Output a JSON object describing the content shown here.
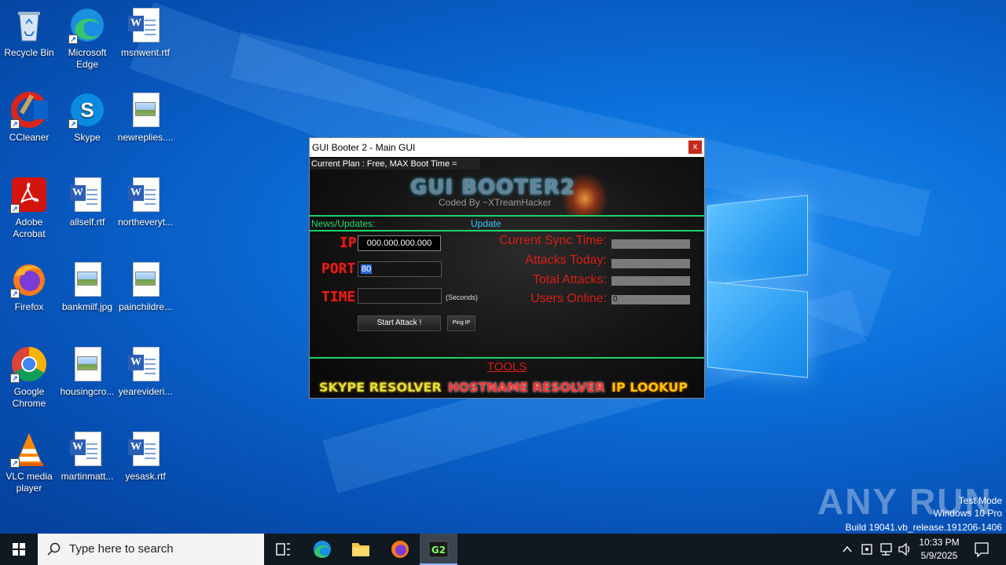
{
  "desktop": {
    "icons": [
      {
        "label": "Recycle Bin"
      },
      {
        "label": "Microsoft Edge"
      },
      {
        "label": "msnwent.rtf"
      },
      {
        "label": "CCleaner"
      },
      {
        "label": "Skype"
      },
      {
        "label": "newreplies...."
      },
      {
        "label": "Adobe Acrobat"
      },
      {
        "label": "allself.rtf"
      },
      {
        "label": "northeveryt..."
      },
      {
        "label": "Firefox"
      },
      {
        "label": "bankmilf.jpg"
      },
      {
        "label": "painchildre..."
      },
      {
        "label": "Google Chrome"
      },
      {
        "label": "housingcro..."
      },
      {
        "label": "yearevideri..."
      },
      {
        "label": "VLC media player"
      },
      {
        "label": "martinmatt..."
      },
      {
        "label": "yesask.rtf"
      }
    ]
  },
  "window": {
    "title": "GUI Booter 2 - Main GUI",
    "close_label": "x",
    "plan_text": "Current Plan : Free,  MAX Boot Time =",
    "logo_text": "GUI BOOTER2",
    "logo_sub": "Coded By ~XTreamHacker",
    "news_label": "News/Updates:",
    "update_label": "Update",
    "ip_label": "IP:",
    "ip_value": "000.000.000.000",
    "port_label": "PORT:",
    "port_value": "80",
    "time_label": "TIME:",
    "time_value": "",
    "seconds_label": "(Seconds)",
    "start_button": "Start Attack !",
    "ping_button": "Ping IP",
    "stats": {
      "sync_label": "Current Sync Time:",
      "attacks_today_label": "Attacks Today:",
      "total_attacks_label": "Total Attacks:",
      "users_online_label": "Users Online:",
      "users_online_value": "0"
    },
    "tools_title": "TOOLS",
    "tools": {
      "skype": "SKYPE RESOLVER",
      "hostname": "HOSTNAME RESOLVER",
      "ip_lookup": "IP LOOKUP"
    }
  },
  "watermark": {
    "brand": "ANY RUN",
    "test_mode": "Test Mode",
    "edition": "Windows 10 Pro",
    "build": "Build 19041.vb_release.191206-1406"
  },
  "taskbar": {
    "search_placeholder": "Type here to search",
    "time": "10:33 PM",
    "date": "5/9/2025"
  },
  "colors": {
    "accent_green": "#19d36a",
    "label_red": "#d81e16",
    "update_blue": "#39c6ff"
  }
}
